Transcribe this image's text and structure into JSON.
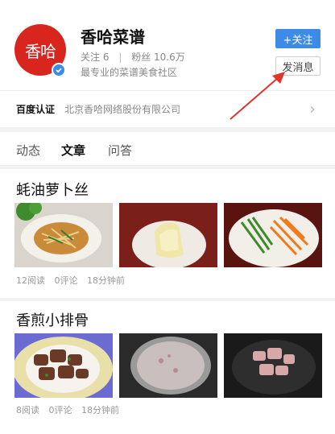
{
  "profile": {
    "avatar_text": "香哈",
    "name": "香哈菜谱",
    "follow_label": "关注",
    "follow_count": "6",
    "fans_label": "粉丝",
    "fans_count": "10.6万",
    "tagline": "最专业的菜谱美食社区",
    "follow_button": "+关注",
    "message_button": "发消息"
  },
  "certification": {
    "label": "百度认证",
    "value": "北京香哈网络股份有限公司"
  },
  "tabs": [
    {
      "label": "动态",
      "active": false
    },
    {
      "label": "文章",
      "active": true
    },
    {
      "label": "问答",
      "active": false
    }
  ],
  "articles": [
    {
      "title": "蚝油萝卜丝",
      "reads": "12阅读",
      "comments": "0评论",
      "time": "18分钟前"
    },
    {
      "title": "香煎小排骨",
      "reads": "8阅读",
      "comments": "0评论",
      "time": "18分钟前"
    }
  ],
  "colors": {
    "accent_blue": "#3d8be8",
    "brand_red": "#d8261f",
    "annotation_red": "#e0352a"
  }
}
